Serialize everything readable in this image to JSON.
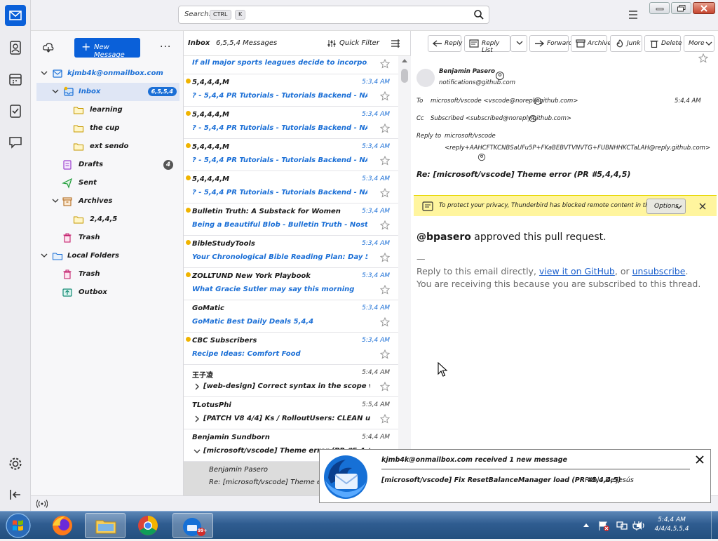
{
  "titlebar": {
    "search_placeholder": "Search...",
    "kbd_ctrl": "CTRL",
    "kbd_k": "K"
  },
  "folderpane": {
    "new_message": "New Message",
    "account": "kjmb4k@onmailbox.com",
    "folders": [
      {
        "label": "Inbox",
        "badge": "6,5,5,4"
      },
      {
        "label": "learning",
        "badge": ""
      },
      {
        "label": "the cup",
        "badge": ""
      },
      {
        "label": "ext sendo",
        "badge": ""
      },
      {
        "label": "Drafts",
        "badge": "4"
      },
      {
        "label": "Sent",
        "badge": ""
      },
      {
        "label": "Archives",
        "badge": ""
      },
      {
        "label": "2,4,4,5",
        "badge": ""
      },
      {
        "label": "Trash",
        "badge": ""
      },
      {
        "label": "Local Folders",
        "badge": ""
      },
      {
        "label": "Trash",
        "badge": ""
      },
      {
        "label": "Outbox",
        "badge": ""
      }
    ]
  },
  "threadpane": {
    "folder_name": "Inbox",
    "count_label": "6,5,5,4 Messages",
    "quick_filter": "Quick Filter",
    "messages": [
      {
        "from": "",
        "subject": "If all major sports leagues decide to incorporate A...",
        "time": "",
        "unread": true,
        "read": false
      },
      {
        "from": "5,4,4,4,M",
        "subject": "? - 5,4,4 PR Tutorials - Tutorials Backend - NATURAL",
        "time": "5:3,4 AM",
        "unread": true,
        "read": false
      },
      {
        "from": "5,4,4,4,M",
        "subject": "? - 5,4,4 PR Tutorials - Tutorials Backend - NATURAL",
        "time": "5:3,4 AM",
        "unread": true,
        "read": false
      },
      {
        "from": "5,4,4,4,M",
        "subject": "? - 5,4,4 PR Tutorials - Tutorials Backend - NATURAL",
        "time": "5:3,4 AM",
        "unread": true,
        "read": false
      },
      {
        "from": "5,4,4,4,M",
        "subject": "? - 5,4,4 PR Tutorials - Tutorials Backend - NATURAL",
        "time": "5:3,4 AM",
        "unread": true,
        "read": false
      },
      {
        "from": "Bulletin Truth: A Substack for Women",
        "subject": "Being a Beautiful Blob - Bulletin Truth - Nostalgia 5,5. 4,...",
        "time": "5:3,4 AM",
        "unread": true,
        "read": false
      },
      {
        "from": "BibleStudyTools",
        "subject": "Your Chronological Bible Reading Plan: Day 5",
        "time": "5:3,4 AM",
        "unread": true,
        "read": false
      },
      {
        "from": "ZOLLTUND New York Playbook",
        "subject": "What Gracie Sutler may say this morning",
        "time": "5:3,4 AM",
        "unread": true,
        "read": false
      },
      {
        "from": "GoMatic",
        "subject": "GoMatic Best Daily Deals 5,4,4",
        "time": "5:3,4 AM",
        "unread": true,
        "read": false
      },
      {
        "from": "CBC Subscribers",
        "subject": "Recipe Ideas: Comfort Food",
        "time": "5:3,4 AM",
        "unread": true,
        "read": false
      },
      {
        "from": "王子凌",
        "subject": "[web-design] Correct syntax in the scope variable when using g...",
        "time": "5:4,4 AM",
        "unread": false,
        "read": true
      },
      {
        "from": "TLotusPhi",
        "subject": "[PATCH V8 4/4] Ks / RolloutUsers: CLEAN users...",
        "time": "5:5,4 AM",
        "unread": false,
        "read": true
      },
      {
        "from": "Benjamin Sundborn",
        "subject": "[microsoft/vscode] Theme error (PR #5,4,4...",
        "time": "5:4,4 AM",
        "unread": false,
        "read": true
      }
    ],
    "expanded_child_from": "Benjamin Pasero",
    "expanded_child_subject": "Re: [microsoft/vscode] Theme error (PR..."
  },
  "msgpane": {
    "toolbar": [
      "Reply",
      "Reply List",
      "Forward",
      "Archive",
      "Junk",
      "Delete",
      "More"
    ],
    "from_name": "Benjamin Pasero",
    "from_email": "notifications@github.com",
    "to_label": "To",
    "to_value": "microsoft/vscode <vscode@noreply.github.com>",
    "cc_label": "Cc",
    "cc_value": "Subscribed <subscribed@noreply.github.com>",
    "reply_to_label": "Reply to",
    "reply_to_value": "microsoft/vscode",
    "reply_to_value2": "<reply+AAHCFTKCNBSaUFu5P+FKaBEBVTVNVTG+FUBNHHKCTaLAH@reply.github.com>",
    "date": "5:4,4 AM",
    "subject": "Re: [microsoft/vscode] Theme error (PR #5,4,4,5)",
    "notice": "To protect your privacy, Thunderbird has blocked remote content in this message.",
    "notice_options": "Options",
    "body_user": "@bpasero",
    "body_lead": "approved this pull request.",
    "body_dash": "—",
    "body_reply_prefix": "Reply to this email directly, ",
    "body_link1": "view it on GitHub",
    "body_mid": ", or ",
    "body_link2": "unsubscribe",
    "body_end": ".",
    "body_subscribed": "You are receiving this because you are subscribed to this thread."
  },
  "popup": {
    "line1": "kjmb4k@onmailbox.com received 1 new message",
    "line2": "[microsoft/vscode] Fix ResetBalanceManager load (PR #5,4,4,5)",
    "line2_from": "Pablo De Jesús"
  },
  "taskbar": {
    "clock_time": "5:4,4 AM",
    "clock_date": "4/4/4,5,5,4",
    "tb_badge": "99+"
  },
  "colors": {
    "accent": "#0a60d9",
    "link": "#1b5fcc",
    "unread_dot": "#f0b400",
    "notice_bg": "#fff59e"
  }
}
